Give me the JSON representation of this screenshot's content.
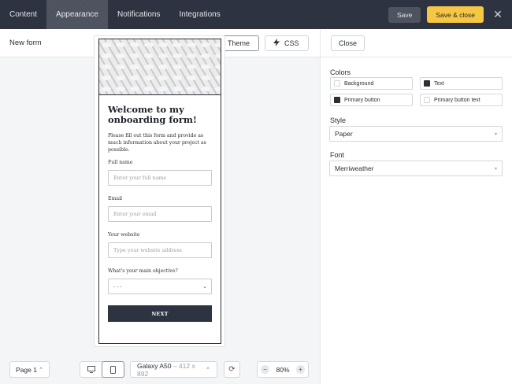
{
  "tabs": [
    {
      "label": "Content",
      "active": false
    },
    {
      "label": "Appearance",
      "active": true
    },
    {
      "label": "Notifications",
      "active": false
    },
    {
      "label": "Integrations",
      "active": false
    }
  ],
  "actions": {
    "save_label": "Save",
    "save_close_label": "Save & close",
    "close_icon": "✕"
  },
  "left_header": {
    "form_name": "New form",
    "theme_label": "Theme",
    "css_label": "CSS"
  },
  "form": {
    "title": "Welcome to my onboarding form!",
    "description": "Please fill out this form and provide as much information about your project as possible.",
    "fields": [
      {
        "label": "Full name",
        "placeholder": "Enter your full name"
      },
      {
        "label": "Email",
        "placeholder": "Enter your email"
      },
      {
        "label": "Your website",
        "placeholder": "Type your website address"
      }
    ],
    "select_field": {
      "label": "What's your main objective?",
      "value": "- - -"
    },
    "next_label": "NEXT"
  },
  "bottom": {
    "page_label": "Page 1",
    "device_name": "Galaxy A50",
    "device_dims": " – 412 x 892",
    "zoom": "80%",
    "zoom_minus": "−",
    "zoom_plus": "+"
  },
  "right_panel": {
    "close_label": "Close",
    "colors_label": "Colors",
    "colors": [
      {
        "label": "Background",
        "swatch": "#ffffff"
      },
      {
        "label": "Text",
        "swatch": "#2b2f36"
      },
      {
        "label": "Primary button",
        "swatch": "#2b2f36"
      },
      {
        "label": "Primary button text",
        "swatch": "#ffffff"
      }
    ],
    "style_label": "Style",
    "style_value": "Paper",
    "font_label": "Font",
    "font_value": "Merriweather"
  },
  "accent_colors": {
    "topbar": "#2d3340",
    "save_close": "#f6c744"
  }
}
